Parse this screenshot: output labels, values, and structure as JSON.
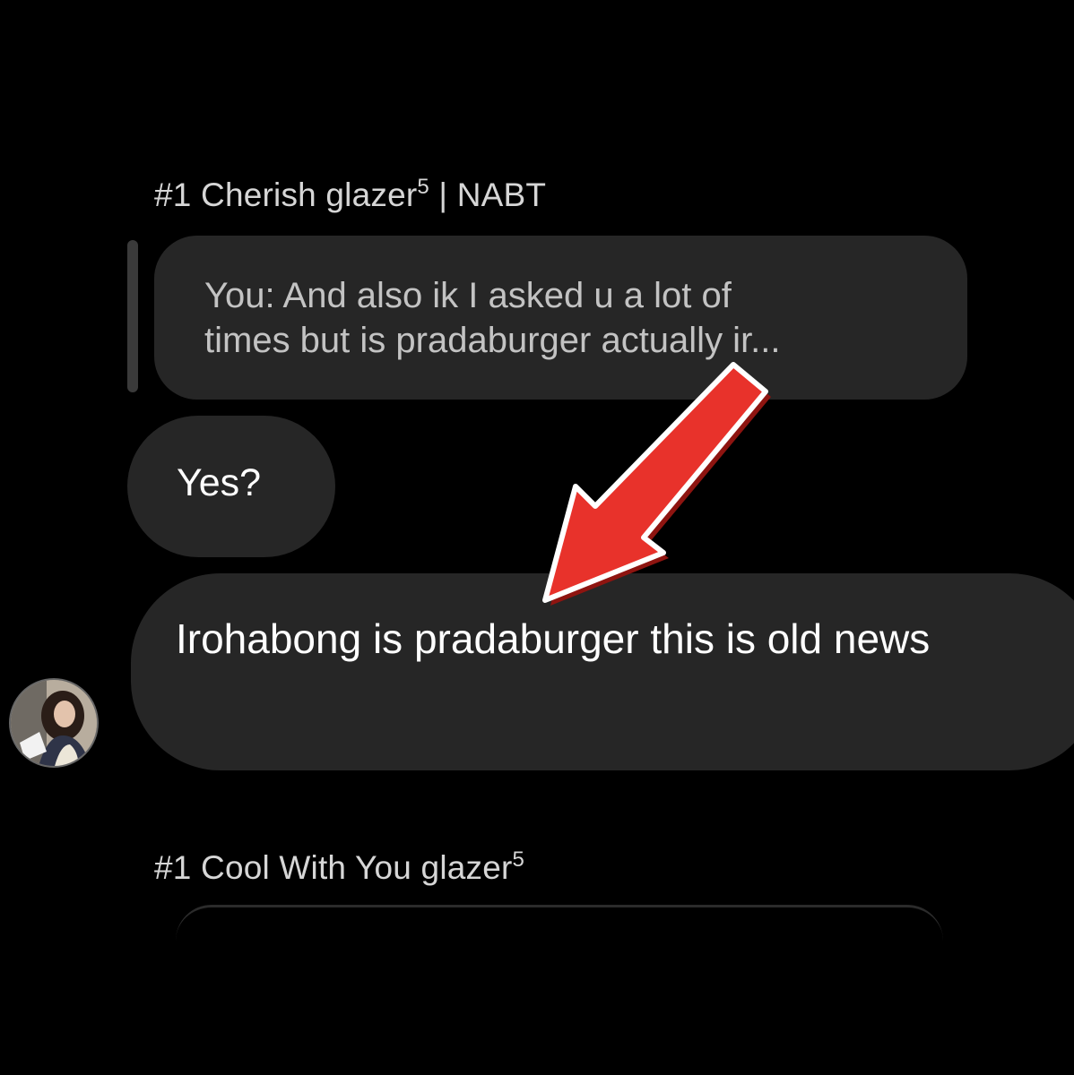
{
  "thread": {
    "sender_1": {
      "name": "#1 Cherish glazer",
      "superscript": "5",
      "suffix": " | NABT"
    },
    "reply": {
      "quoted_line_1": "You: And also ik I asked u a lot of",
      "quoted_line_2": "times but is pradaburger actually ir..."
    },
    "messages": [
      {
        "text": "Yes?"
      },
      {
        "text": "Irohabong is pradaburger this is old news"
      }
    ],
    "sender_2": {
      "name": "#1 Cool With You glazer",
      "superscript": "5"
    }
  },
  "annotation": {
    "arrow_color": "#e8322b",
    "arrow_outline": "#ffffff",
    "icon": "red-arrow-icon"
  },
  "colors": {
    "background": "#000000",
    "bubble": "#262626",
    "text": "#ffffff",
    "muted_text": "#c3c3c3"
  }
}
